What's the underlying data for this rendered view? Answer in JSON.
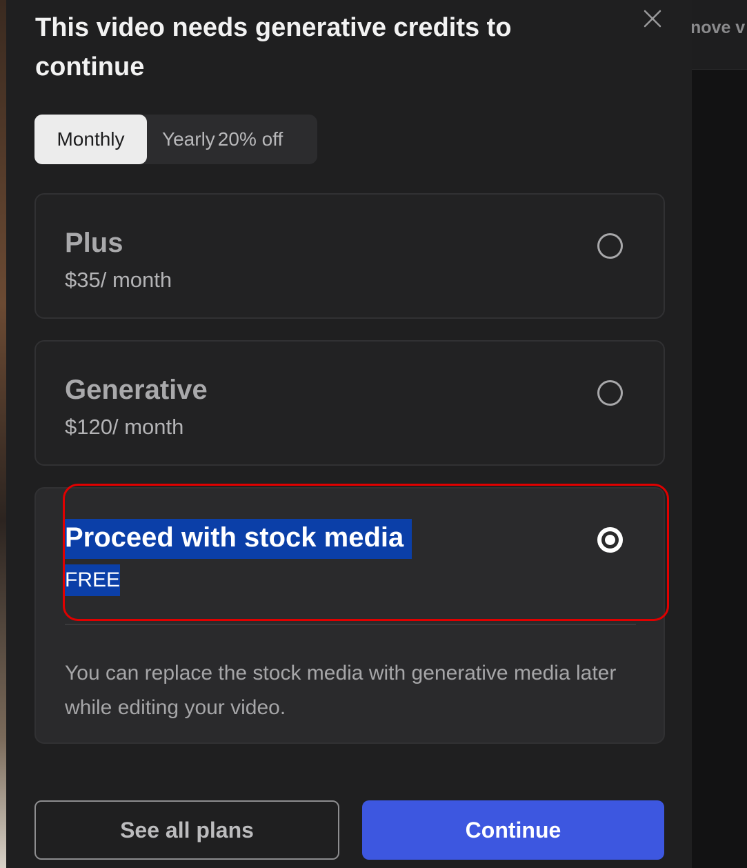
{
  "modal": {
    "title": "This video needs generative credits to continue",
    "close_icon": "close-icon"
  },
  "billing_toggle": {
    "monthly_label": "Monthly",
    "yearly_label": "Yearly",
    "yearly_discount": "20% off",
    "selected": "Monthly"
  },
  "plans": [
    {
      "name": "Plus",
      "price": "$35/ month",
      "selected": false
    },
    {
      "name": "Generative",
      "price": "$120/ month",
      "selected": false
    }
  ],
  "stock_option": {
    "name": "Proceed with stock media",
    "price": "FREE",
    "description": "You can replace the stock media with generative media later while editing your video.",
    "selected": true
  },
  "background": {
    "partial_text": "nove v"
  },
  "buttons": {
    "see_all_plans": "See all plans",
    "continue": "Continue"
  },
  "colors": {
    "modal_bg": "#1f1f20",
    "primary_button": "#3d57e0",
    "text_selection": "#0b3fa8",
    "annotation_outline": "#e00000"
  }
}
